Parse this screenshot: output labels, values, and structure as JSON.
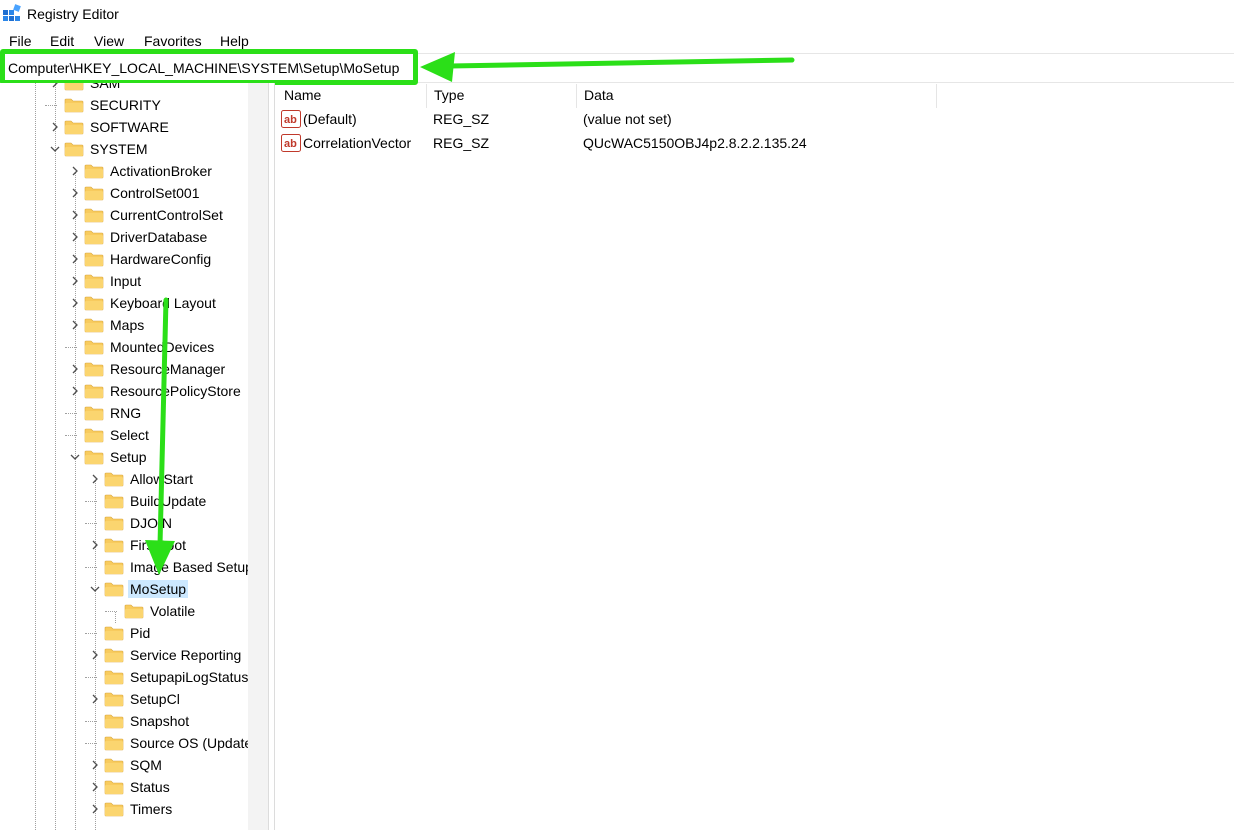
{
  "window": {
    "title": "Registry Editor",
    "icon": "registry-editor-icon"
  },
  "menu": [
    "File",
    "Edit",
    "View",
    "Favorites",
    "Help"
  ],
  "address": {
    "path": "Computer\\HKEY_LOCAL_MACHINE\\SYSTEM\\Setup\\MoSetup"
  },
  "tree": [
    {
      "label": "SAM",
      "level": 1,
      "expand": "collapsed"
    },
    {
      "label": "SECURITY",
      "level": 1,
      "expand": "none"
    },
    {
      "label": "SOFTWARE",
      "level": 1,
      "expand": "collapsed"
    },
    {
      "label": "SYSTEM",
      "level": 1,
      "expand": "expanded"
    },
    {
      "label": "ActivationBroker",
      "level": 2,
      "expand": "collapsed"
    },
    {
      "label": "ControlSet001",
      "level": 2,
      "expand": "collapsed"
    },
    {
      "label": "CurrentControlSet",
      "level": 2,
      "expand": "collapsed"
    },
    {
      "label": "DriverDatabase",
      "level": 2,
      "expand": "collapsed"
    },
    {
      "label": "HardwareConfig",
      "level": 2,
      "expand": "collapsed"
    },
    {
      "label": "Input",
      "level": 2,
      "expand": "collapsed"
    },
    {
      "label": "Keyboard Layout",
      "level": 2,
      "expand": "collapsed"
    },
    {
      "label": "Maps",
      "level": 2,
      "expand": "collapsed"
    },
    {
      "label": "MountedDevices",
      "level": 2,
      "expand": "none"
    },
    {
      "label": "ResourceManager",
      "level": 2,
      "expand": "collapsed"
    },
    {
      "label": "ResourcePolicyStore",
      "level": 2,
      "expand": "collapsed"
    },
    {
      "label": "RNG",
      "level": 2,
      "expand": "none"
    },
    {
      "label": "Select",
      "level": 2,
      "expand": "none"
    },
    {
      "label": "Setup",
      "level": 2,
      "expand": "expanded"
    },
    {
      "label": "AllowStart",
      "level": 3,
      "expand": "collapsed"
    },
    {
      "label": "BuildUpdate",
      "level": 3,
      "expand": "none"
    },
    {
      "label": "DJOIN",
      "level": 3,
      "expand": "none"
    },
    {
      "label": "FirstBoot",
      "level": 3,
      "expand": "collapsed"
    },
    {
      "label": "Image Based Setup",
      "level": 3,
      "expand": "none"
    },
    {
      "label": "MoSetup",
      "level": 3,
      "expand": "expanded",
      "selected": true
    },
    {
      "label": "Volatile",
      "level": 4,
      "expand": "none"
    },
    {
      "label": "Pid",
      "level": 3,
      "expand": "none"
    },
    {
      "label": "Service Reporting",
      "level": 3,
      "expand": "collapsed"
    },
    {
      "label": "SetupapiLogStatus",
      "level": 3,
      "expand": "none"
    },
    {
      "label": "SetupCl",
      "level": 3,
      "expand": "collapsed"
    },
    {
      "label": "Snapshot",
      "level": 3,
      "expand": "none"
    },
    {
      "label": "Source OS (Updated)",
      "level": 3,
      "expand": "none"
    },
    {
      "label": "SQM",
      "level": 3,
      "expand": "collapsed"
    },
    {
      "label": "Status",
      "level": 3,
      "expand": "collapsed"
    },
    {
      "label": "Timers",
      "level": 3,
      "expand": "collapsed"
    }
  ],
  "list": {
    "columns": {
      "name": "Name",
      "type": "Type",
      "data": "Data"
    },
    "rows": [
      {
        "icon": "string-value-icon",
        "name": "(Default)",
        "type": "REG_SZ",
        "data": "(value not set)"
      },
      {
        "icon": "string-value-icon",
        "name": "CorrelationVector",
        "type": "REG_SZ",
        "data": "QUcWAC5150OBJ4p2.8.2.2.135.24"
      }
    ]
  },
  "colors": {
    "annotation": "#2bdf18",
    "selection": "#cce8ff",
    "folder": "#f8cb5e"
  }
}
